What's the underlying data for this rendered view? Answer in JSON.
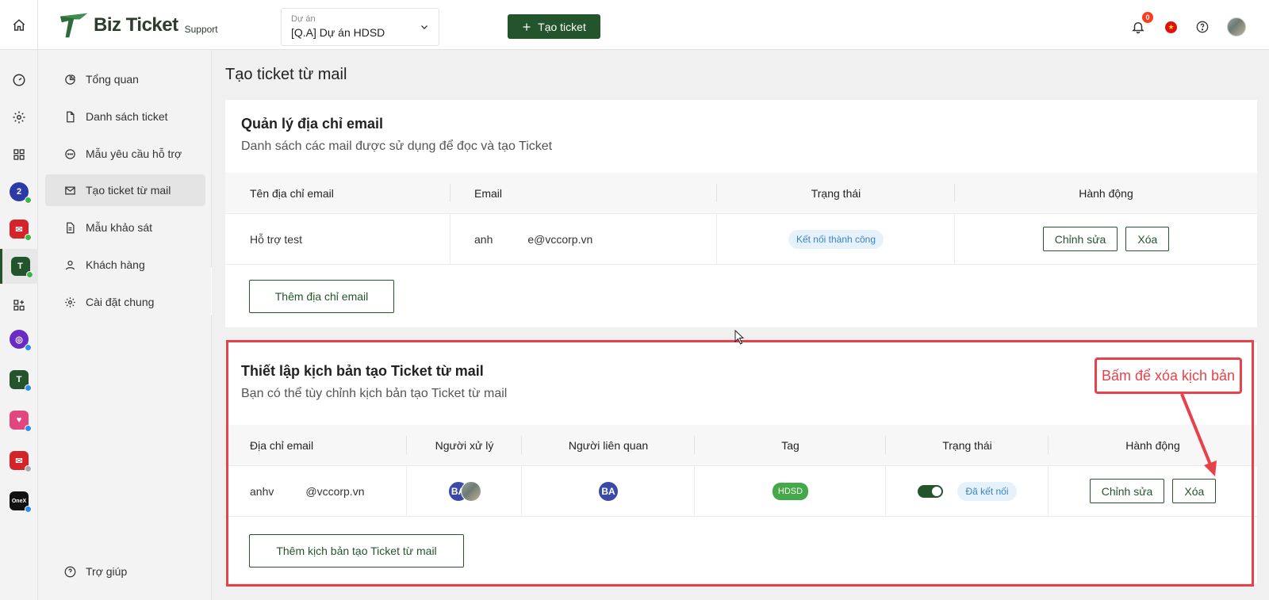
{
  "header": {
    "logo_main": "Biz Ticket",
    "logo_sub": "Support",
    "project_label": "Dự án",
    "project_value": "[Q.A] Dự án HDSD",
    "create_label": "Tạo ticket",
    "notification_count": "0"
  },
  "sidebar": {
    "items": [
      {
        "label": "Tổng quan",
        "icon": "pie-chart-icon"
      },
      {
        "label": "Danh sách ticket",
        "icon": "document-icon"
      },
      {
        "label": "Mẫu yêu cầu hỗ trợ",
        "icon": "chat-dots-icon"
      },
      {
        "label": "Tạo ticket từ mail",
        "icon": "mail-icon"
      },
      {
        "label": "Mẫu khảo sát",
        "icon": "form-icon"
      },
      {
        "label": "Khách hàng",
        "icon": "user-icon"
      },
      {
        "label": "Cài đặt chung",
        "icon": "gear-icon"
      }
    ],
    "help_label": "Trợ giúp",
    "active_index": 3
  },
  "page": {
    "title": "Tạo ticket từ mail"
  },
  "email_card": {
    "title": "Quản lý địa chỉ email",
    "description": "Danh sách các mail được sử dụng để đọc và tạo Ticket",
    "columns": [
      "Tên địa chỉ email",
      "Email",
      "Trạng thái",
      "Hành động"
    ],
    "rows": [
      {
        "name": "Hỗ trợ test",
        "email_prefix": "anh",
        "email_suffix": "e@vccorp.vn",
        "status": "Kết nối thành công"
      }
    ],
    "edit_label": "Chỉnh sửa",
    "delete_label": "Xóa",
    "add_label": "Thêm địa chỉ email"
  },
  "script_card": {
    "title": "Thiết lập kịch bản tạo Ticket từ mail",
    "description": "Bạn có thể tùy chỉnh kịch bản tạo Ticket từ mail",
    "columns": [
      "Địa chỉ email",
      "Người xử lý",
      "Người liên quan",
      "Tag",
      "Trạng thái",
      "Hành động"
    ],
    "rows": [
      {
        "email_prefix": "anhv",
        "email_suffix": "@vccorp.vn",
        "handler_initials": "BA",
        "related_initials": "BA",
        "tag": "HDSD",
        "status": "Đã kết nối",
        "enabled": true
      }
    ],
    "edit_label": "Chỉnh sửa",
    "delete_label": "Xóa",
    "add_label": "Thêm kịch bản tạo Ticket từ mail"
  },
  "annotation": {
    "callout_text": "Bấm để xóa kịch bản",
    "color": "#e8414b"
  },
  "colors": {
    "primary": "#24542c",
    "status_bg": "#e6f2fb",
    "status_text": "#3b82c4",
    "tag": "#44a948",
    "avatar": "#3a4aa6"
  }
}
